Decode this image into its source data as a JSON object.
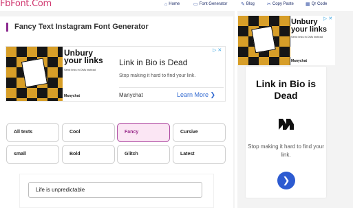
{
  "site": {
    "logo": "FbFont.Com"
  },
  "nav": [
    {
      "label": "Home",
      "icon": "home-icon"
    },
    {
      "label": "Font Generator",
      "icon": "monitor-icon"
    },
    {
      "label": "Blog",
      "icon": "blog-icon"
    },
    {
      "label": "Copy Paste",
      "icon": "copy-paste-icon"
    },
    {
      "label": "Qr Code",
      "icon": "qr-code-icon"
    }
  ],
  "page": {
    "heading": "Fancy Text Instagram Font Generator"
  },
  "ad_banner": {
    "image_headline": "Unbury your links",
    "image_small": "Send links in DMs instead",
    "image_brand": "Manychat",
    "title": "Link in Bio is Dead",
    "subtitle": "Stop making it hard to find your link.",
    "brand": "Manychat",
    "cta": "Learn More ❯",
    "close": "▷ ✕"
  },
  "categories": [
    {
      "label": "All texts",
      "active": false
    },
    {
      "label": "Cool",
      "active": false
    },
    {
      "label": "Fancy",
      "active": true
    },
    {
      "label": "Cursive",
      "active": false
    },
    {
      "label": "small",
      "active": false
    },
    {
      "label": "Bold",
      "active": false
    },
    {
      "label": "Glitch",
      "active": false
    },
    {
      "label": "Latest",
      "active": false
    }
  ],
  "input": {
    "value": "Life is unpredictable"
  },
  "side_ad": {
    "image_headline": "Unbury your links",
    "image_small": "Send links in DMs instead",
    "image_brand": "Manychat",
    "close": "▷ ✕",
    "title": "Link in Bio is Dead",
    "subtitle": "Stop making it hard to find your link.",
    "arrow": "❯"
  },
  "colors": {
    "accent": "#8b2a8f",
    "active_bg": "#fbe6f4",
    "logo": "#d0376f",
    "cta": "#3068d0",
    "arrow_bg": "#2d5bd1"
  }
}
